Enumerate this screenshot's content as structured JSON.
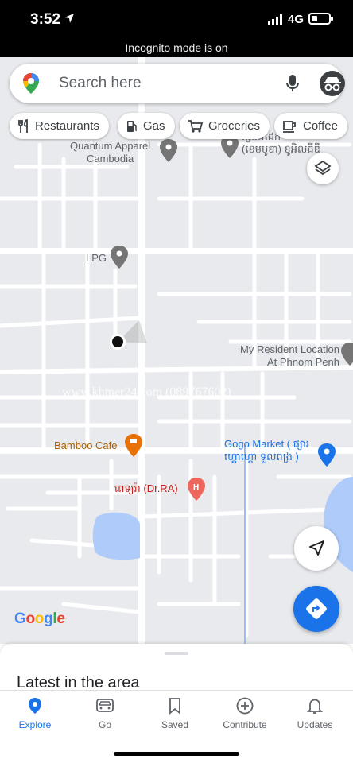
{
  "status_bar": {
    "time": "3:52",
    "network": "4G",
    "battery_level": 0.35,
    "incognito_text": "Incognito mode is on",
    "location_icon": "location-arrow-icon",
    "signal_icon": "signal-bars-icon",
    "battery_icon": "battery-icon"
  },
  "search": {
    "placeholder": "Search here",
    "logo_icon": "maps-pin-icon",
    "mic_icon": "mic-icon",
    "avatar_icon": "incognito-avatar-icon"
  },
  "chips": [
    {
      "label": "Restaurants",
      "icon": "fork-knife-icon"
    },
    {
      "label": "Gas",
      "icon": "gas-pump-icon"
    },
    {
      "label": "Groceries",
      "icon": "cart-icon"
    },
    {
      "label": "Coffee",
      "icon": "coffee-cup-icon"
    }
  ],
  "map": {
    "places": {
      "quantum": "Quantum Apparel\nCambodia",
      "khmer_place": "ផ្សារដីដែក\n(ខេមបូឌា) ខូអិលធីឌី",
      "lpg": "LPG",
      "resident": "My Resident Location\nAt Phnom Penh",
      "bamboo": "Bamboo Cafe",
      "gogo": "Gogo Market ( ផ្សារ\nហ្គោហ្គោ ទួលពង្រ )",
      "hospital": "ពេទ្យរ៉ា (Dr.RA)"
    },
    "watermark": "www.khmer24.com (089767602)",
    "logo": "Google",
    "colors": {
      "background": "#e8eaed",
      "road": "#ffffff",
      "water": "#aecbfa",
      "accent_blue": "#1a73e8"
    },
    "layers_icon": "layers-icon",
    "locate_icon": "navigation-arrow-icon",
    "directions_icon": "directions-icon"
  },
  "sheet": {
    "title": "Latest in the area"
  },
  "nav": [
    {
      "label": "Explore",
      "icon": "explore-pin-icon",
      "active": true
    },
    {
      "label": "Go",
      "icon": "car-icon",
      "active": false
    },
    {
      "label": "Saved",
      "icon": "bookmark-icon",
      "active": false
    },
    {
      "label": "Contribute",
      "icon": "plus-circle-icon",
      "active": false
    },
    {
      "label": "Updates",
      "icon": "bell-icon",
      "active": false
    }
  ]
}
